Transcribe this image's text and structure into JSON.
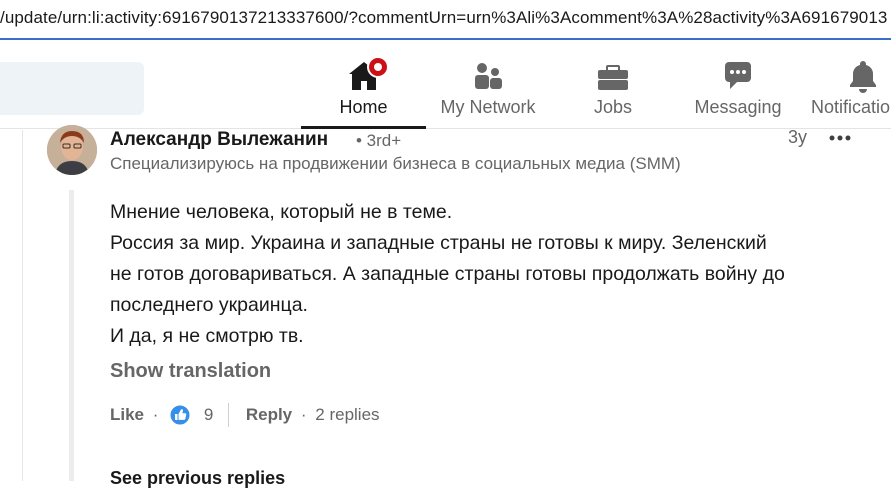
{
  "browser": {
    "url": "/update/urn:li:activity:6916790137213337600/?commentUrn=urn%3Ali%3Acomment%3A%28activity%3A691679013"
  },
  "nav": {
    "items": [
      {
        "label": "Home",
        "icon": "home-icon",
        "active": true
      },
      {
        "label": "My Network",
        "icon": "network-icon",
        "active": false
      },
      {
        "label": "Jobs",
        "icon": "briefcase-icon",
        "active": false
      },
      {
        "label": "Messaging",
        "icon": "messaging-icon",
        "active": false
      },
      {
        "label": "Notificatio",
        "icon": "bell-icon",
        "active": false
      }
    ]
  },
  "comment": {
    "author_name": "Александр Вылежанин",
    "author_degree": "• 3rd+",
    "author_headline": "Специализируюсь на продвижении бизнеса в социальных медиа (SMM)",
    "timestamp": "3y",
    "lines": [
      "Мнение человека, который не в теме.",
      "Россия за мир. Украина и западные страны не готовы к миру. Зеленский",
      "не готов договариваться. А западные страны готовы продолжать войну до",
      "последнего украинца.",
      "И да, я не смотрю тв."
    ],
    "show_translation": "Show translation",
    "like_label": "Like",
    "dot": "·",
    "like_count": "9",
    "reply_label": "Reply",
    "replies_text": "2 replies",
    "see_previous": "See previous replies"
  },
  "colors": {
    "accent": "#0a66c2",
    "notification": "#cc1016",
    "muted_text": "#666666",
    "primary_text": "#191919"
  }
}
